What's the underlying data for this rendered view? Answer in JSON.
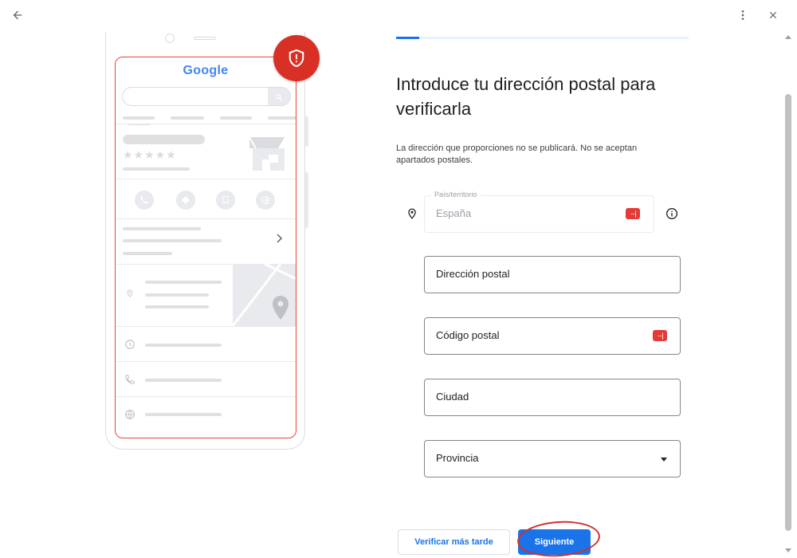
{
  "nav": {
    "back_icon": "arrow-left-icon",
    "more_icon": "more-vert-icon",
    "close_icon": "close-icon"
  },
  "illustration": {
    "brand": "Google",
    "rating_stars": "★★★★★",
    "shield_icon": "shield-alert-icon",
    "badge_color": "#d93025",
    "outline_color": "#ea4335"
  },
  "progress": {
    "fraction": 0.08
  },
  "form": {
    "title": "Introduce tu dirección postal para verificarla",
    "description": "La dirección que proporciones no se publicará. No se aceptan apartados postales.",
    "country": {
      "float_label": "País/territorio",
      "value": "España"
    },
    "street": {
      "label": "Dirección postal"
    },
    "postal_code": {
      "label": "Código postal"
    },
    "city": {
      "label": "Ciudad"
    },
    "province": {
      "label": "Provincia"
    },
    "password_badge": "···|"
  },
  "actions": {
    "later_label": "Verificar más tarde",
    "next_label": "Siguiente"
  },
  "colors": {
    "accent": "#1a73e8",
    "annotation": "#d32f2f"
  }
}
